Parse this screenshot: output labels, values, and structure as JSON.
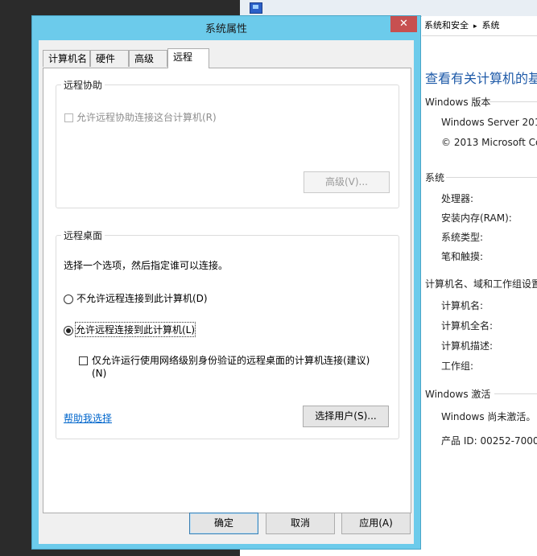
{
  "background_window": {
    "breadcrumb": [
      "系统和安全",
      "系统"
    ],
    "breadcrumb_sep": "▸",
    "heading": "查看有关计算机的基",
    "windows_edition_section": "Windows 版本",
    "edition_name": "Windows Server 201",
    "copyright": "© 2013 Microsoft Co",
    "system_section": "系统",
    "processor_label": "处理器:",
    "ram_label": "安装内存(RAM):",
    "system_type_label": "系统类型:",
    "pen_touch_label": "笔和触摸:",
    "computer_section": "计算机名、域和工作组设置",
    "computer_name_label": "计算机名:",
    "full_name_label": "计算机全名:",
    "description_label": "计算机描述:",
    "workgroup_label": "工作组:",
    "activation_section": "Windows 激活",
    "activation_status": "Windows 尚未激活。",
    "product_id": "产品 ID: 00252-70000"
  },
  "dialog": {
    "title": "系统属性",
    "close_glyph": "✕",
    "tabs": [
      {
        "label": "计算机名",
        "active": false
      },
      {
        "label": "硬件",
        "active": false
      },
      {
        "label": "高级",
        "active": false
      },
      {
        "label": "远程",
        "active": true
      }
    ],
    "remote_assistance": {
      "legend": "远程协助",
      "allow_label": "允许远程协助连接这台计算机(R)",
      "allow_checked": false,
      "advanced_button": "高级(V)..."
    },
    "remote_desktop": {
      "legend": "远程桌面",
      "instruction": "选择一个选项，然后指定谁可以连接。",
      "option_disallow": "不允许远程连接到此计算机(D)",
      "option_allow": "允许远程连接到此计算机(L)",
      "selected_option": "allow",
      "nla_label_line1": "仅允许运行使用网络级别身份验证的远程桌面的计算机连接(建议)",
      "nla_label_line2": "(N)",
      "nla_checked": false,
      "help_link": "帮助我选择",
      "select_users_button": "选择用户(S)..."
    },
    "buttons": {
      "ok": "确定",
      "cancel": "取消",
      "apply": "应用(A)"
    }
  }
}
